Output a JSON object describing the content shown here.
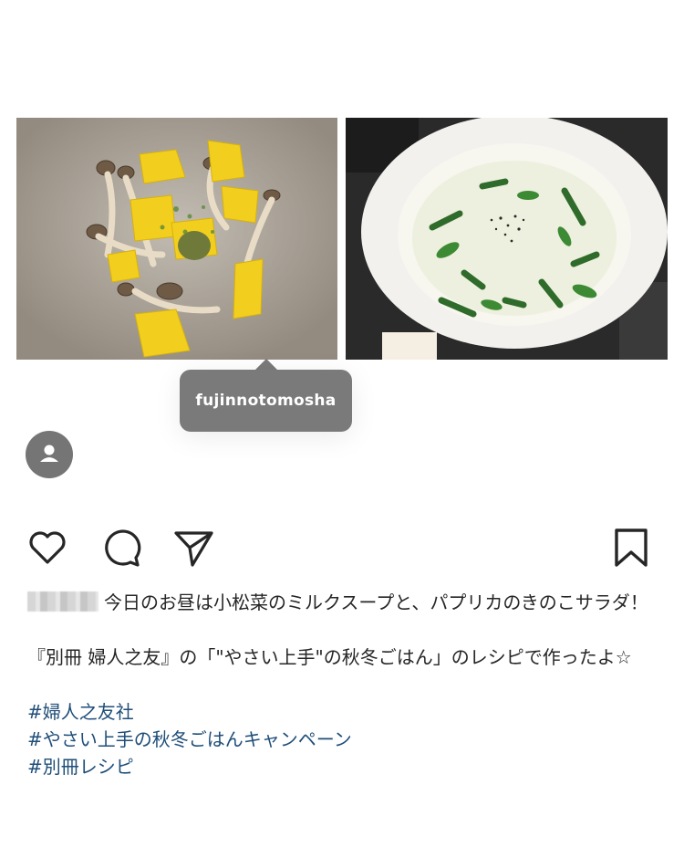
{
  "post": {
    "tagged_user": "fujinnotomosha",
    "caption": {
      "line1": "今日のお昼は小松菜のミルクスープと、パプリカのきのこサラダ！",
      "line2": "『別冊 婦人之友』の「\"やさい上手\"の秋冬ごはん」のレシピで作ったよ☆",
      "hashtags": [
        "#婦人之友社",
        "#やさい上手の秋冬ごはんキャンペーン",
        "#別冊レシピ"
      ]
    }
  },
  "icons": {
    "user_tag": "person-icon",
    "like": "heart-icon",
    "comment": "comment-icon",
    "share": "send-icon",
    "save": "bookmark-icon"
  },
  "colors": {
    "hashtag": "#1f4e79",
    "tag_bubble": "#7a7a7a",
    "icon": "#262626"
  }
}
